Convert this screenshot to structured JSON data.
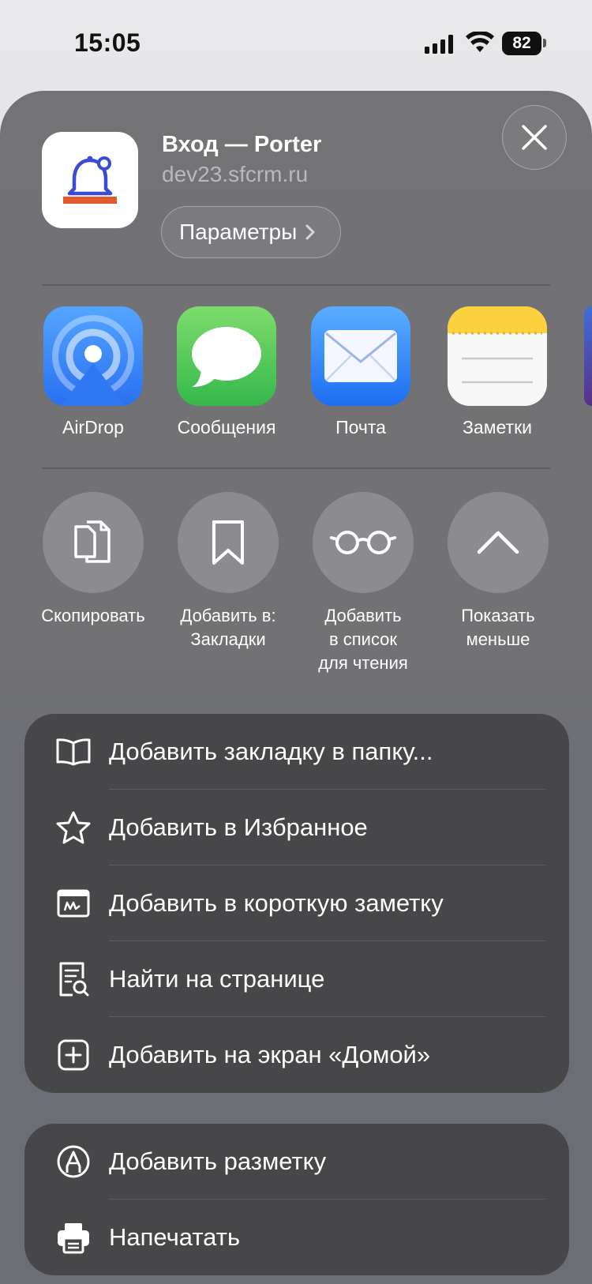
{
  "status_bar": {
    "time": "15:05",
    "battery": "82"
  },
  "share_header": {
    "title": "Вход — Porter",
    "url": "dev23.sfcrm.ru",
    "options_button": "Параметры",
    "close_label": "Close"
  },
  "apps": [
    {
      "label": "AirDrop",
      "icon": "airdrop-icon"
    },
    {
      "label": "Сообщения",
      "icon": "messages-icon"
    },
    {
      "label": "Почта",
      "icon": "mail-icon"
    },
    {
      "label": "Заметки",
      "icon": "notes-icon"
    }
  ],
  "actions": [
    {
      "line1": "Скопировать",
      "line2": "",
      "line3": "",
      "icon": "copy-icon"
    },
    {
      "line1": "Добавить в:",
      "line2": "Закладки",
      "line3": "",
      "icon": "bookmark-icon"
    },
    {
      "line1": "Добавить",
      "line2": "в список",
      "line3": "для чтения",
      "icon": "reading-glasses-icon"
    },
    {
      "line1": "Показать",
      "line2": "меньше",
      "line3": "",
      "icon": "chevron-up-icon"
    }
  ],
  "menu_group_1": [
    {
      "label": "Добавить закладку в папку...",
      "icon": "book-icon"
    },
    {
      "label": "Добавить в Избранное",
      "icon": "star-icon"
    },
    {
      "label": "Добавить в короткую заметку",
      "icon": "quick-note-icon"
    },
    {
      "label": "Найти на странице",
      "icon": "find-on-page-icon"
    },
    {
      "label": "Добавить на экран «Домой»",
      "icon": "add-square-icon"
    }
  ],
  "menu_group_2": [
    {
      "label": "Добавить разметку",
      "icon": "markup-pen-icon"
    },
    {
      "label": "Напечатать",
      "icon": "printer-icon"
    }
  ],
  "colors": {
    "sheet": "#6e6e72",
    "menu_group": "#47474a",
    "action_circle": "#8c8c90",
    "brand_bell": "#3b4bd8",
    "brand_bar": "#e05a2b"
  }
}
